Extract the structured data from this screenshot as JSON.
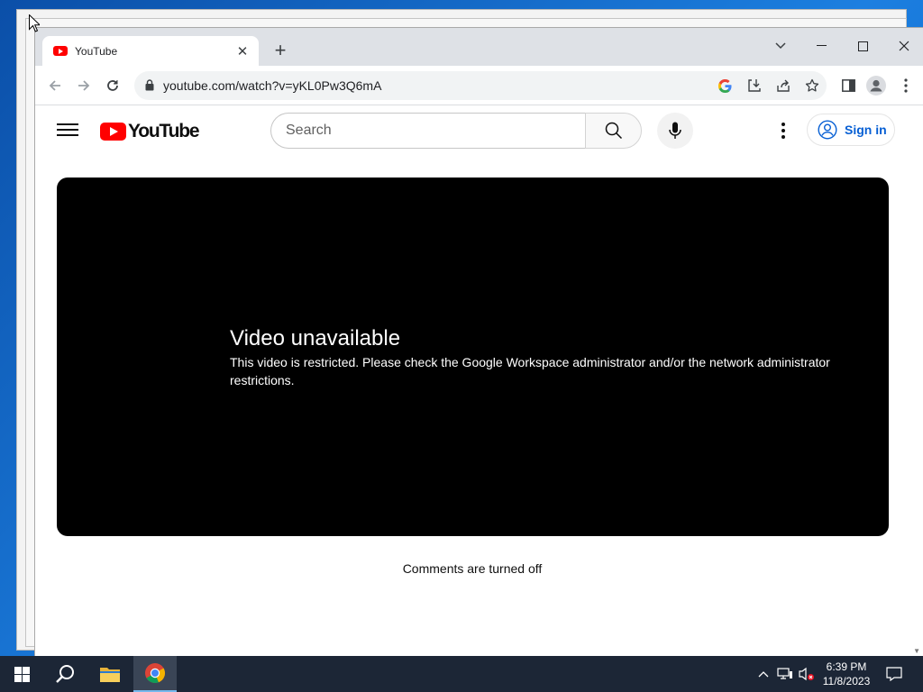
{
  "browser": {
    "tab_title": "YouTube",
    "url": "youtube.com/watch?v=yKL0Pw3Q6mA"
  },
  "youtube": {
    "logo_text": "YouTube",
    "search_placeholder": "Search",
    "signin_label": "Sign in",
    "error_title": "Video unavailable",
    "error_message": "This video is restricted. Please check the Google Workspace administrator and/or the network administrator restrictions.",
    "comments_status": "Comments are turned off"
  },
  "taskbar": {
    "time": "6:39 PM",
    "date": "11/8/2023"
  },
  "colors": {
    "youtube_red": "#ff0000",
    "link_blue": "#065fd4",
    "player_bg": "#000000",
    "taskbar_bg": "#1c2636"
  }
}
